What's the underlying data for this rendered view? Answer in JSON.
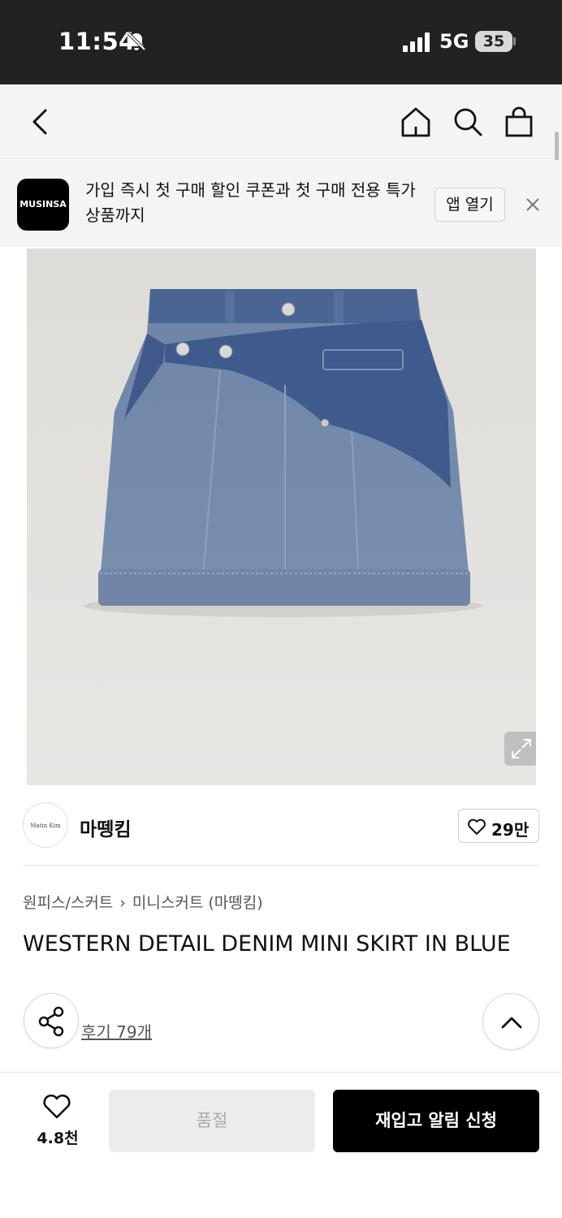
{
  "status_bar": {
    "time": "11:54",
    "network": "5G",
    "battery": "35",
    "icons": [
      "bell-off-icon",
      "signal-icon"
    ]
  },
  "header": {
    "icons": [
      "back-icon",
      "home-icon",
      "search-icon",
      "bag-icon"
    ]
  },
  "banner": {
    "logo_text": "MUSINSA",
    "text": "가입 즉시 첫 구매 할인 쿠폰과 첫 구매 전용 특가 상품까지",
    "open_app_label": "앱 열기",
    "close_icon": "close-icon"
  },
  "brand": {
    "logo_text": "Matin Kim",
    "name": "마뗑킴",
    "likes": "29만"
  },
  "product": {
    "breadcrumb": [
      "원피스/스커트",
      "미니스커트 (마뗑킴)"
    ],
    "title": "WESTERN DETAIL DENIM MINI SKIRT IN BLUE",
    "reviews": "후기 79개"
  },
  "action_bar": {
    "wish_count": "4.8천",
    "soldout_label": "품절",
    "restock_label": "재입고 알림 신청"
  },
  "colors": {
    "status_bg": "#222222",
    "header_bg": "#f4f4f4",
    "primary_button": "#000000",
    "disabled_button": "#ececec",
    "denim_light": "#7388a6",
    "denim_dark": "#3d5a8c"
  }
}
